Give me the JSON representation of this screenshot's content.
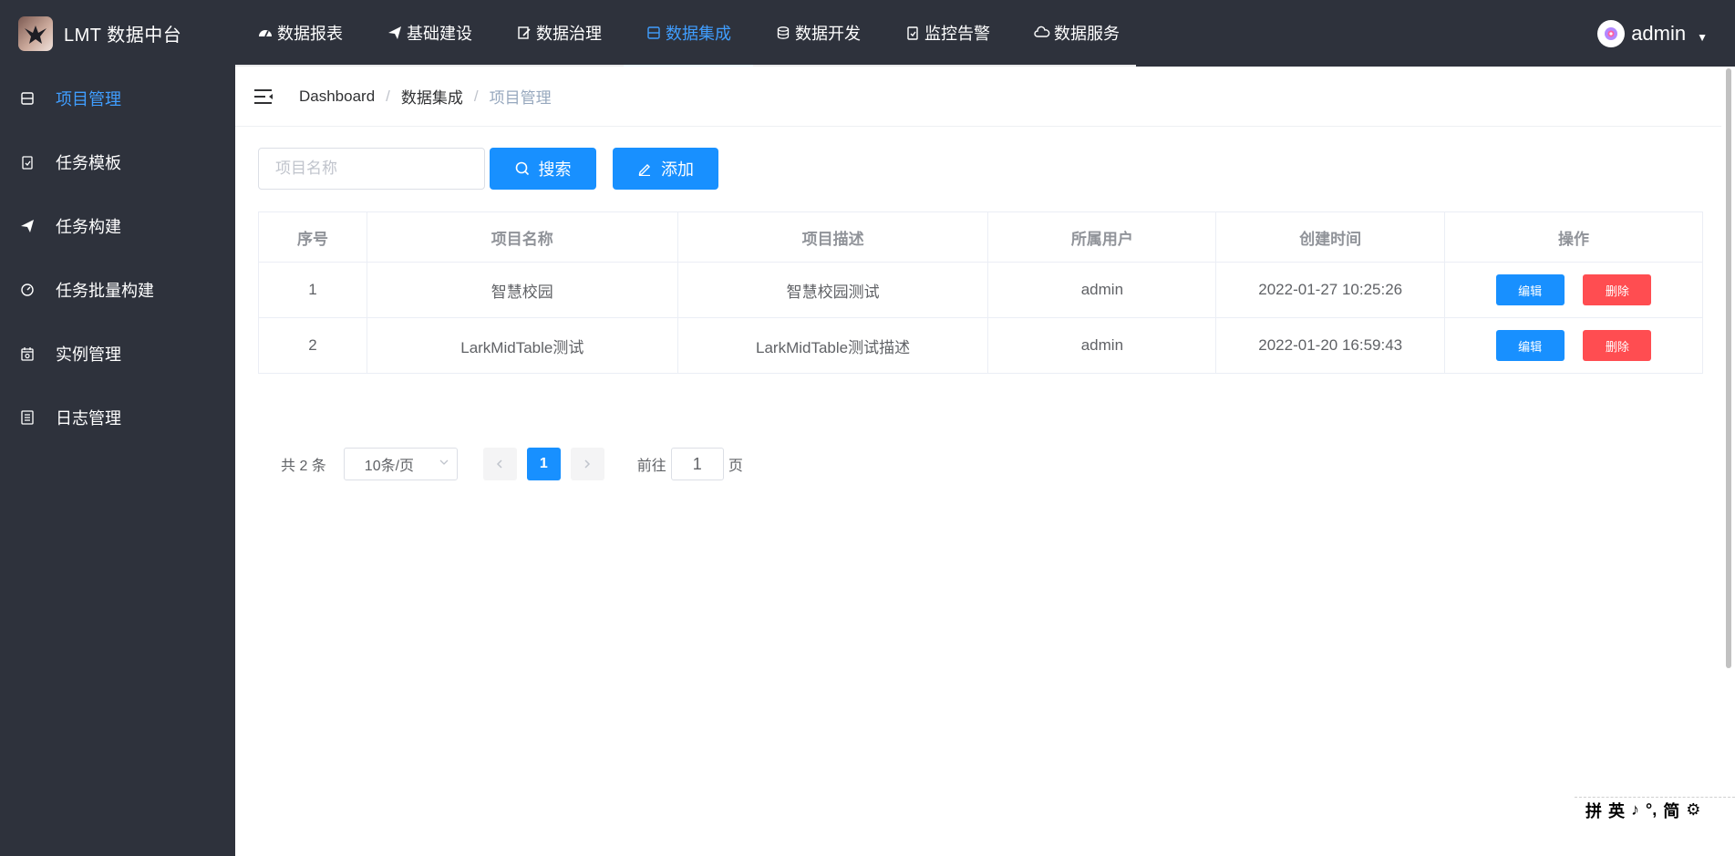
{
  "brand": {
    "title": "LMT 数据中台"
  },
  "topnav": [
    {
      "label": "数据报表",
      "icon": "dashboard-icon"
    },
    {
      "label": "基础建设",
      "icon": "paper-plane-icon"
    },
    {
      "label": "数据治理",
      "icon": "edit-document-icon"
    },
    {
      "label": "数据集成",
      "icon": "inbox-icon",
      "active": true
    },
    {
      "label": "数据开发",
      "icon": "database-icon"
    },
    {
      "label": "监控告警",
      "icon": "clipboard-icon"
    },
    {
      "label": "数据服务",
      "icon": "cloud-icon"
    }
  ],
  "user": {
    "name": "admin"
  },
  "sidebar": [
    {
      "label": "项目管理",
      "icon": "inbox-icon",
      "active": true
    },
    {
      "label": "任务模板",
      "icon": "clipboard-check-icon"
    },
    {
      "label": "任务构建",
      "icon": "paper-plane-icon"
    },
    {
      "label": "任务批量构建",
      "icon": "gauge-icon"
    },
    {
      "label": "实例管理",
      "icon": "calendar-icon"
    },
    {
      "label": "日志管理",
      "icon": "document-list-icon"
    }
  ],
  "breadcrumb": {
    "home": "Dashboard",
    "section": "数据集成",
    "current": "项目管理"
  },
  "toolbar": {
    "search_placeholder": "项目名称",
    "search_label": "搜索",
    "add_label": "添加"
  },
  "table": {
    "headers": [
      "序号",
      "项目名称",
      "项目描述",
      "所属用户",
      "创建时间",
      "操作"
    ],
    "rows": [
      {
        "index": "1",
        "name": "智慧校园",
        "desc": "智慧校园测试",
        "user": "admin",
        "created": "2022-01-27 10:25:26"
      },
      {
        "index": "2",
        "name": "LarkMidTable测试",
        "desc": "LarkMidTable测试描述",
        "user": "admin",
        "created": "2022-01-20 16:59:43"
      }
    ],
    "edit_label": "编辑",
    "delete_label": "删除"
  },
  "pagination": {
    "total": "共 2 条",
    "page_size": "10条/页",
    "current": "1",
    "goto_prefix": "前往",
    "goto_value": "1",
    "goto_suffix": "页"
  },
  "ime": [
    "拼",
    "英",
    "♪",
    "°,",
    "简",
    "⚙"
  ],
  "colors": {
    "accent": "#409eff",
    "primary_button": "#1890ff",
    "danger_button": "#ff4d51",
    "sidebar_bg": "#2e323c"
  }
}
